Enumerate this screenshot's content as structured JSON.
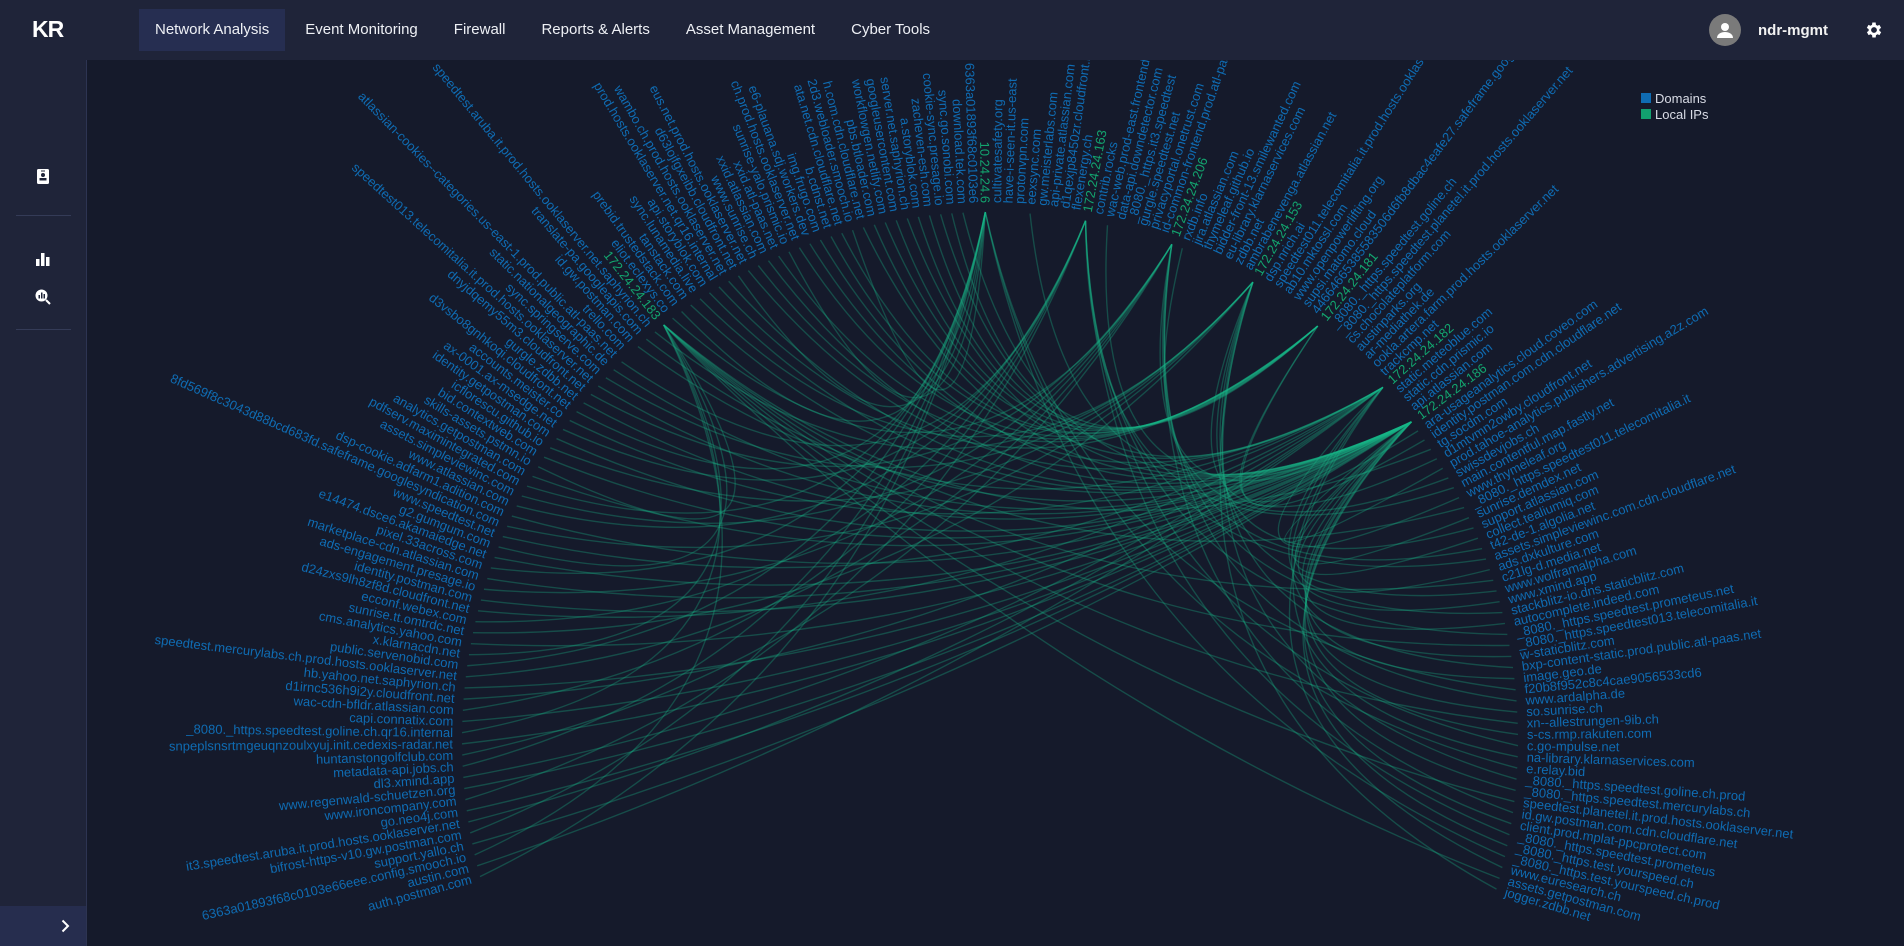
{
  "header": {
    "logo": "KR",
    "tabs": [
      {
        "label": "Network Analysis",
        "active": true
      },
      {
        "label": "Event Monitoring"
      },
      {
        "label": "Firewall"
      },
      {
        "label": "Reports & Alerts"
      },
      {
        "label": "Asset Management"
      },
      {
        "label": "Cyber Tools"
      }
    ],
    "username": "ndr-mgmt",
    "icons": {
      "avatar": "user-avatar-icon",
      "settings": "gear-icon"
    }
  },
  "sidebar": {
    "icons": [
      "id-badge-icon",
      "bar-chart-icon",
      "search-chart-icon"
    ],
    "expand_icon": "chevron-right-icon"
  },
  "legend": {
    "items": [
      {
        "label": "Domains",
        "color": "#0f6cb3"
      },
      {
        "label": "Local IPs",
        "color": "#12a06f"
      }
    ]
  },
  "colors": {
    "domain": "#0f6cb3",
    "ip": "#13a56f",
    "link": "#19b888"
  },
  "chord_data": {
    "nodes": [
      [
        "auth.postman.com",
        "d"
      ],
      [
        "austin.com",
        "d"
      ],
      [
        "6363a01893f68c0103e66eee.config.smooch.io",
        "d"
      ],
      [
        "support.yallo.ch",
        "d"
      ],
      [
        "bifrost-https-v10.gw.postman.com",
        "d"
      ],
      [
        "it3.speedtest.aruba.it.prod.hosts.ooklaserver.net",
        "d"
      ],
      [
        "go.neo4j.com",
        "d"
      ],
      [
        "www.ironcompany.com",
        "d"
      ],
      [
        "www.regenwald-schuetzen.org",
        "d"
      ],
      [
        "dl3.xmind.app",
        "d"
      ],
      [
        "metadata-api.jobs.ch",
        "d"
      ],
      [
        "huntanstongolfclub.com",
        "d"
      ],
      [
        "snpeplsnsrtmgeuqnzoulxyuj.init.cedexis-radar.net",
        "d"
      ],
      [
        "_8080._https.speedtest.goline.ch.qr16.internal",
        "d"
      ],
      [
        "capi.connatix.com",
        "d"
      ],
      [
        "wac-cdn-bfldr.atlassian.com",
        "d"
      ],
      [
        "d1irnc536h9i2y.cloudfront.net",
        "d"
      ],
      [
        "hb.yahoo.net.saphyrion.ch",
        "d"
      ],
      [
        "speedtest.mercurylabs.ch.prod.hosts.ooklaserver.net",
        "d"
      ],
      [
        "public.servenobid.com",
        "d"
      ],
      [
        "x.klarnacdn.net",
        "d"
      ],
      [
        "cms.analytics.yahoo.com",
        "d"
      ],
      [
        "sunrise.tt.omtrdc.net",
        "d"
      ],
      [
        "ecconf.webex.com",
        "d"
      ],
      [
        "d24zxs9lh8zf8d.cloudfront.net",
        "d"
      ],
      [
        "identity.postman.com",
        "d"
      ],
      [
        "ads-engagement.presage.io",
        "d"
      ],
      [
        "marketplace-cdn.atlassian.com",
        "d"
      ],
      [
        "pixel.33across.com",
        "d"
      ],
      [
        "e14474.dsce6.akamaiedge.net",
        "d"
      ],
      [
        "g2.gumgum.com",
        "d"
      ],
      [
        "www.speedtest.net",
        "d"
      ],
      [
        "8fd569f8c3043d88bcd683fd.safeframe.googlesyndication.com",
        "d"
      ],
      [
        "dsp-cookie.adfarm1.adition.com",
        "d"
      ],
      [
        "www.atlassian.com",
        "d"
      ],
      [
        "assets.simpleviewinc.com",
        "d"
      ],
      [
        "pdfserv.maximintegrated.com",
        "d"
      ],
      [
        "analytics.getpostman.com",
        "d"
      ],
      [
        "skills-assets.pstmn.io",
        "d"
      ],
      [
        "bid.contextweb.com",
        "d"
      ],
      [
        "icflorescu.github.io",
        "d"
      ],
      [
        "identity.getpostman.com",
        "d"
      ],
      [
        "ax-0001.ax-msedge.net",
        "d"
      ],
      [
        "accounts.meister.co",
        "d"
      ],
      [
        "d3vsbo8gnhkoqi.cloudfront.net",
        "d"
      ],
      [
        "gurgle.zdbb.net",
        "d"
      ],
      [
        "dnyjdqemy55m3.cloudfront.net",
        "d"
      ],
      [
        "speedtest013.telecomitalia.it.prod.hosts.ooklaserver.net",
        "d"
      ],
      [
        "sync.springserve.com",
        "d"
      ],
      [
        "static.nationalgeographic.de",
        "d"
      ],
      [
        "atlassian-cookies--categories.us-east-1.prod.public.atl-paas.net",
        "d"
      ],
      [
        "trello.com",
        "d"
      ],
      [
        "id.gw.postman.com",
        "d"
      ],
      [
        "translate-pa.googleapis.com",
        "d"
      ],
      [
        "speedtest.aruba.it.prod.hosts.ooklaserver.net.saphyrion.ch",
        "d"
      ],
      [
        "172.24.24.183",
        "ip"
      ],
      [
        "eliot.eclexys.co",
        "d"
      ],
      [
        "prebid.trustedstack.com",
        "d"
      ],
      [
        "tanstack.com",
        "d"
      ],
      [
        "sync.lunamedia.live",
        "d"
      ],
      [
        "api.storyblok.com",
        "d"
      ],
      [
        "prod.hosts.ooklaserver.net.qr16.internal",
        "d"
      ],
      [
        "wambo.ch.prod.hosts.ooklaserver.net",
        "d"
      ],
      [
        "d63lojfgxeibb.cloudfront.net",
        "d"
      ],
      [
        "eus.net.prod.hosts.ooklaserver.net",
        "d"
      ],
      [
        "www.sunrise.ch",
        "d"
      ],
      [
        "xxid.atlassian.com",
        "d"
      ],
      [
        "xxid.atl-paas.net",
        "d"
      ],
      [
        "sunrise-yalo.prismic.io",
        "d"
      ],
      [
        "ch.prod.hosts.ooklaserver.net",
        "d"
      ],
      [
        "e6-plauana.sdj.workers.dev",
        "d"
      ],
      [
        "img.frugo.com",
        "d"
      ],
      [
        "b.cdnst.net",
        "d"
      ],
      [
        "ata.net.cdn.cloudflare.net",
        "d"
      ],
      [
        "2d3.webloader.smooch.io",
        "d"
      ],
      [
        "h.com.cdn.cloudflare.net",
        "d"
      ],
      [
        "pbs.btloader.com",
        "d"
      ],
      [
        "workflowgen.netlify.com",
        "d"
      ],
      [
        "googleusercontent.com",
        "d"
      ],
      [
        "server.net.saphyrion.ch",
        "d"
      ],
      [
        "a.storyblok.com",
        "d"
      ],
      [
        "zacheven-esh.com",
        "d"
      ],
      [
        "cookie-sync.presage.io",
        "d"
      ],
      [
        "sync.go.sonobi.com",
        "d"
      ],
      [
        "download.tek.com",
        "d"
      ],
      [
        "6363a01893f68c0103e6",
        "d"
      ],
      [
        "10.24.24.6",
        "ip"
      ],
      [
        "cultivatesafety.org",
        "d"
      ],
      [
        "have-i-seen-it.us-east",
        "d"
      ],
      [
        "protonvpn.com",
        "d"
      ],
      [
        "eexsync.com",
        "d"
      ],
      [
        "gw.meisterlabs.com",
        "d"
      ],
      [
        "api-private.atlassian.com",
        "d"
      ],
      [
        "d1qexjp8450zr.cloudfront.net",
        "d"
      ],
      [
        "flexenergy.ch",
        "d"
      ],
      [
        "172.24.24.163",
        "ip"
      ],
      [
        "contrib.rocks",
        "d"
      ],
      [
        "wac-web.prod-east.frontend",
        "d"
      ],
      [
        "data-api.downdetector.com",
        "d"
      ],
      [
        "_8080._https.it3.speedtest",
        "d"
      ],
      [
        "gurgle.speedtest.net",
        "d"
      ],
      [
        "privacyportal.onetrust.com",
        "d"
      ],
      [
        "id-common-frontend.prod.atl-paas.net",
        "d"
      ],
      [
        "172.24.24.206",
        "ip"
      ],
      [
        "rxdb.info",
        "d"
      ],
      [
        "jira.atlassian.com",
        "d"
      ],
      [
        "thymeleaf.github.io",
        "d"
      ],
      [
        "bidder-front-13.smilewanted.com",
        "d"
      ],
      [
        "eu-library.klarnaservices.com",
        "d"
      ],
      [
        "zdbb.net",
        "d"
      ],
      [
        "ambrabenevenga.atlassian.net",
        "d"
      ],
      [
        "172.24.24.153",
        "ip"
      ],
      [
        "dsp.nrich.ai",
        "d"
      ],
      [
        "speedtest011.telecomitalia.it.prod.hosts.ooklaserver.net",
        "d"
      ],
      [
        "ab10.mktossl.com",
        "d"
      ],
      [
        "www.openpowerlifting.org",
        "d"
      ],
      [
        "supsi.matomo.cloud",
        "d"
      ],
      [
        "44664665385583506d6fb8dbac4eafe27.safeframe.googlesyndication.com",
        "d"
      ],
      [
        "172.24.24.181",
        "ip"
      ],
      [
        "_8080._https.speedtest.goline.ch",
        "d"
      ],
      [
        "_8080._https.speedtest.planetel.it.prod.hosts.ooklaserver.net",
        "d"
      ],
      [
        "cs.chocolateplatform.com",
        "d"
      ],
      [
        "austinparks.org",
        "d"
      ],
      [
        "ar-mediathek.de",
        "d"
      ],
      [
        "ookla.artera.farm.prod.hosts.ooklaserver.net",
        "d"
      ],
      [
        "trackcmp.net",
        "d"
      ],
      [
        "172.24.24.182",
        "ip"
      ],
      [
        "static.meteoblue.com",
        "d"
      ],
      [
        "static.cdn.prismic.io",
        "d"
      ],
      [
        "api.atlassian.com",
        "d"
      ],
      [
        "172.24.24.186",
        "ip"
      ],
      [
        "ara-usageanalytics.cloud.coveo.com",
        "d"
      ],
      [
        "identity.postman.com.cdn.cloudflare.net",
        "d"
      ],
      [
        "tg.socdm.com",
        "d"
      ],
      [
        "d1mtvmn2owby.cloudfront.net",
        "d"
      ],
      [
        "prod.tahoe-analytics.publishers.advertising.a2z.com",
        "d"
      ],
      [
        "swissdevjobs.ch",
        "d"
      ],
      [
        "main.contentful.map.fastly.net",
        "d"
      ],
      [
        "www.thymeleaf.org",
        "d"
      ],
      [
        "_8080._https.speedtest011.telecomitalia.it",
        "d"
      ],
      [
        "sunrise.demdex.net",
        "d"
      ],
      [
        "support.atlassian.com",
        "d"
      ],
      [
        "collect.tealiumiq.com",
        "d"
      ],
      [
        "t42-de-1.algolia.net",
        "d"
      ],
      [
        "assets.simpleviewinc.com.cdn.cloudflare.net",
        "d"
      ],
      [
        "ads.dxkulture.com",
        "d"
      ],
      [
        "c21lg-d.media.net",
        "d"
      ],
      [
        "www.wolframalpha.com",
        "d"
      ],
      [
        "www.xmind.app",
        "d"
      ],
      [
        "stackblitz-io.dns.staticblitz.com",
        "d"
      ],
      [
        "autocomplete.indeed.com",
        "d"
      ],
      [
        "_8080._https.speedtest.prometeus.net",
        "d"
      ],
      [
        "_8080._https.speedtest013.telecomitalia.it",
        "d"
      ],
      [
        "w-staticblitz.com",
        "d"
      ],
      [
        "bxp-content-static.prod.public.atl-paas.net",
        "d"
      ],
      [
        "image.geo.de",
        "d"
      ],
      [
        "f20b8f952c8c4cae9056533cd6",
        "d"
      ],
      [
        "www.ardalpha.de",
        "d"
      ],
      [
        "so.sunrise.ch",
        "d"
      ],
      [
        "xn--allestrungen-9ib.ch",
        "d"
      ],
      [
        "s-cs.rmp.rakuten.com",
        "d"
      ],
      [
        "c.go-mpulse.net",
        "d"
      ],
      [
        "na-library.klarnaservices.com",
        "d"
      ],
      [
        "e.relay.bid",
        "d"
      ],
      [
        "_8080._https.speedtest.goline.ch.prod",
        "d"
      ],
      [
        "_8080._https.speedtest.mercurylabs.ch",
        "d"
      ],
      [
        "speedtest.planetel.it.prod.hosts.ooklaserver.net",
        "d"
      ],
      [
        "id.gw.postman.com.cdn.cloudflare.net",
        "d"
      ],
      [
        "client.prod.mplat-ppcprotect.com",
        "d"
      ],
      [
        "_8080._https.speedtest.prometeus",
        "d"
      ],
      [
        "_8080._https.test.yourspeed.ch",
        "d"
      ],
      [
        "_8080._https.test.yourspeed.ch.prod",
        "d"
      ],
      [
        "www.euresearch.ch",
        "d"
      ],
      [
        "assets.getpostman.com",
        "d"
      ],
      [
        "jogger.zdbb.net",
        "d"
      ]
    ],
    "links": [
      {
        "ip": 130,
        "targets": [
          3,
          8,
          12,
          17,
          21,
          25,
          29,
          33,
          37,
          41,
          45,
          49,
          53,
          58,
          62,
          66,
          71,
          75,
          79,
          84,
          90,
          97,
          104,
          140,
          145,
          150,
          155,
          160,
          165,
          170,
          6,
          14,
          27,
          39,
          47,
          60,
          135,
          142,
          158,
          168
        ]
      },
      {
        "ip": 126,
        "targets": [
          1,
          5,
          9,
          16,
          24,
          31,
          43,
          52,
          64,
          70,
          77,
          82,
          138,
          148,
          153,
          162,
          172
        ]
      },
      {
        "ip": 86,
        "targets": [
          0,
          4,
          10,
          19,
          28,
          36,
          44,
          57,
          63,
          68,
          74,
          156,
          163,
          171
        ]
      },
      {
        "ip": 55,
        "targets": [
          2,
          13,
          20,
          30,
          38,
          133,
          139,
          146,
          152,
          159,
          166,
          173
        ]
      },
      {
        "ip": 95,
        "targets": [
          7,
          15,
          23,
          34,
          42,
          50,
          137,
          144,
          151,
          161,
          169
        ]
      },
      {
        "ip": 103,
        "targets": [
          11,
          18,
          26,
          35,
          46,
          56,
          136,
          143,
          149,
          157,
          167
        ]
      },
      {
        "ip": 111,
        "targets": [
          22,
          32,
          40,
          48,
          54,
          59,
          134,
          141,
          147,
          154,
          164,
          174
        ]
      },
      {
        "ip": 118,
        "targets": [
          61,
          65,
          67,
          69,
          72,
          73,
          76,
          78,
          80,
          81,
          83,
          131,
          132
        ]
      }
    ]
  }
}
